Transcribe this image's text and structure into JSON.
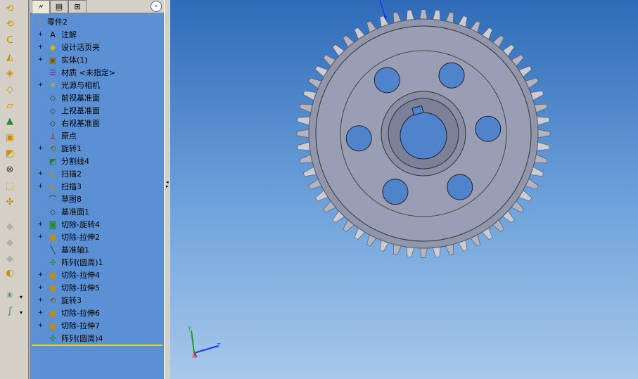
{
  "toolbar": {
    "icons": [
      "revolve-boss-icon",
      "revolve-boss-icon",
      "sweep-boss-icon",
      "loft-boss-icon",
      "fillet-icon",
      "chamfer-icon",
      "plane-icon",
      "draft-icon",
      "shell-icon",
      "rib-icon",
      "cut-icon",
      "extrude-cut-icon",
      "circular-pattern-icon",
      "disabled-tool-icon",
      "disabled-tool-icon",
      "disabled-tool-icon",
      "wrap-icon",
      "reference-geometry-icon",
      "curves-icon"
    ]
  },
  "tabs": {
    "feature_manager": "feature-tree-tab",
    "property_manager": "property-tab",
    "configuration_manager": "configuration-tab",
    "expand": "»"
  },
  "tree": {
    "root": "零件2",
    "items": [
      {
        "label": "注解",
        "icon": "annotation-icon",
        "expandable": true
      },
      {
        "label": "设计活页夹",
        "icon": "design-binder-icon",
        "expandable": true
      },
      {
        "label": "实体(1)",
        "icon": "solid-bodies-icon",
        "expandable": true
      },
      {
        "label": "材质 <未指定>",
        "icon": "material-icon",
        "expandable": false
      },
      {
        "label": "光源与相机",
        "icon": "lights-camera-icon",
        "expandable": true
      },
      {
        "label": "前视基准面",
        "icon": "plane-icon",
        "expandable": false
      },
      {
        "label": "上视基准面",
        "icon": "plane-icon",
        "expandable": false
      },
      {
        "label": "右视基准面",
        "icon": "plane-icon",
        "expandable": false
      },
      {
        "label": "原点",
        "icon": "origin-icon",
        "expandable": false
      },
      {
        "label": "旋转1",
        "icon": "revolve-icon",
        "expandable": true
      },
      {
        "label": "分割线4",
        "icon": "split-line-icon",
        "expandable": false
      },
      {
        "label": "扫描2",
        "icon": "sweep-icon",
        "expandable": true
      },
      {
        "label": "扫描3",
        "icon": "sweep-icon",
        "expandable": true
      },
      {
        "label": "草图8",
        "icon": "sketch-icon",
        "expandable": false
      },
      {
        "label": "基准面1",
        "icon": "plane-icon",
        "expandable": false
      },
      {
        "label": "切除-旋转4",
        "icon": "cut-revolve-icon",
        "expandable": true
      },
      {
        "label": "切除-拉伸2",
        "icon": "cut-extrude-icon",
        "expandable": true
      },
      {
        "label": "基准轴1",
        "icon": "axis-icon",
        "expandable": false
      },
      {
        "label": "阵列(圆周)1",
        "icon": "circular-pattern-icon",
        "expandable": false
      },
      {
        "label": "切除-拉伸4",
        "icon": "cut-extrude-icon",
        "expandable": true
      },
      {
        "label": "切除-拉伸5",
        "icon": "cut-extrude-icon",
        "expandable": true
      },
      {
        "label": "旋转3",
        "icon": "revolve-icon",
        "expandable": true
      },
      {
        "label": "切除-拉伸6",
        "icon": "cut-extrude-icon",
        "expandable": true
      },
      {
        "label": "切除-拉伸7",
        "icon": "cut-extrude-icon",
        "expandable": true
      },
      {
        "label": "阵列(圆周)4",
        "icon": "circular-pattern-icon",
        "expandable": false
      }
    ]
  },
  "triad": {
    "x": "X",
    "y": "Y",
    "z": "Z"
  },
  "colors": {
    "panel": "#5b90d4",
    "viewport_top": "#2f6bb8",
    "viewport_bottom": "#a8c8ea",
    "gear": "#9a9eb4"
  }
}
